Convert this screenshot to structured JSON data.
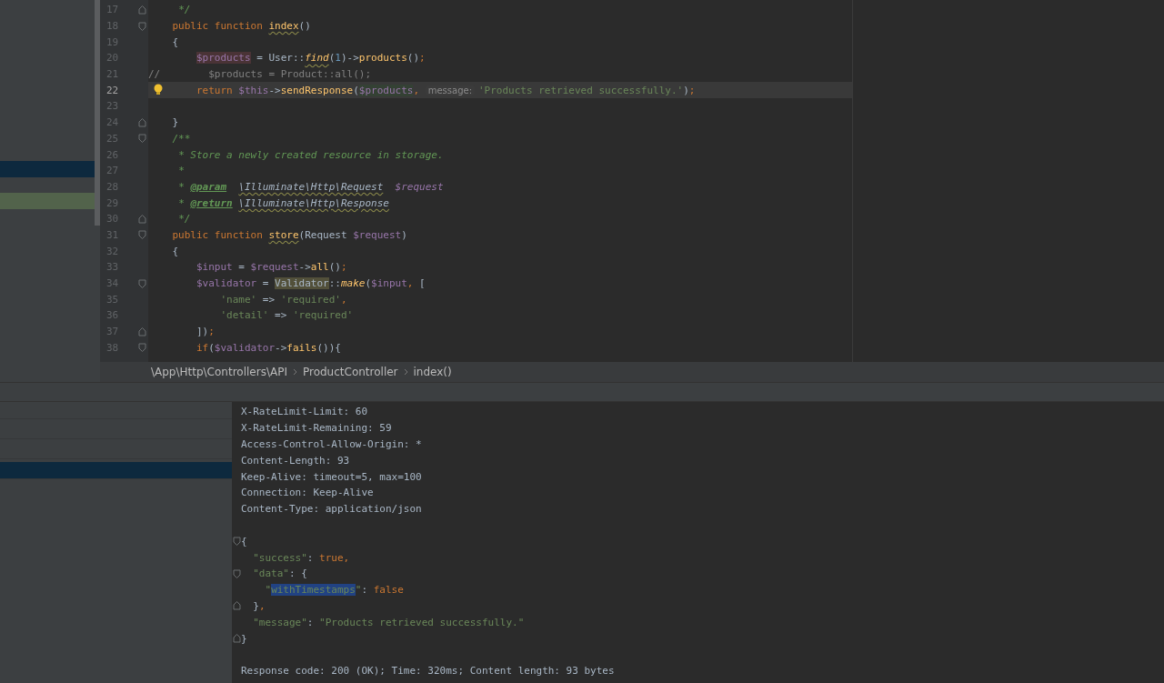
{
  "sidebar": {
    "rows": [
      {
        "selected": false,
        "current": false
      },
      {
        "selected": false,
        "current": false
      },
      {
        "selected": false,
        "current": false
      },
      {
        "selected": false,
        "current": false
      },
      {
        "selected": false,
        "current": false
      },
      {
        "selected": false,
        "current": false
      },
      {
        "selected": false,
        "current": false
      },
      {
        "selected": false,
        "current": false
      },
      {
        "selected": false,
        "current": false
      },
      {
        "selected": false,
        "current": false
      },
      {
        "selected": true,
        "current": false
      },
      {
        "selected": false,
        "current": false
      },
      {
        "selected": false,
        "current": true
      }
    ]
  },
  "editor": {
    "lines": [
      {
        "number": "17",
        "current": false,
        "fold_start": false,
        "fold_end": true,
        "tokens": [
          {
            "kind": "doc",
            "text": "     */"
          }
        ]
      },
      {
        "number": "18",
        "current": false,
        "fold_start": true,
        "fold_end": false,
        "tokens": [
          {
            "kind": "keyword",
            "text": "    public function "
          },
          {
            "kind": "function",
            "text": "index",
            "squiggle": true
          },
          {
            "kind": "plain",
            "text": "()"
          }
        ]
      },
      {
        "number": "19",
        "current": false,
        "fold_start": false,
        "fold_end": false,
        "tokens": [
          {
            "kind": "plain",
            "text": "    {"
          }
        ]
      },
      {
        "number": "20",
        "current": false,
        "fold_start": false,
        "fold_end": false,
        "tokens": [
          {
            "kind": "variable",
            "text": "        $products",
            "highlight": true,
            "color": "#4a3336"
          },
          {
            "kind": "plain",
            "text": " = User::"
          },
          {
            "kind": "static",
            "text": "find",
            "squiggle": true
          },
          {
            "kind": "plain",
            "text": "("
          },
          {
            "kind": "number",
            "text": "1"
          },
          {
            "kind": "plain",
            "text": ")->"
          },
          {
            "kind": "function",
            "text": "products"
          },
          {
            "kind": "plain",
            "text": "()"
          },
          {
            "kind": "keyword",
            "text": ";"
          }
        ]
      },
      {
        "number": "21",
        "current": false,
        "fold_start": false,
        "fold_end": false,
        "tokens": [
          {
            "kind": "dim",
            "text": "//        $products = Product::all();"
          }
        ]
      },
      {
        "number": "22",
        "current": true,
        "bulb": true,
        "fold_start": false,
        "fold_end": false,
        "tokens": [
          {
            "kind": "keyword",
            "text": "        return "
          },
          {
            "kind": "variable",
            "text": "$this"
          },
          {
            "kind": "plain",
            "text": "->"
          },
          {
            "kind": "function",
            "text": "sendResponse"
          },
          {
            "kind": "plain",
            "text": "("
          },
          {
            "kind": "variable",
            "text": "$products",
            "highlight": true,
            "color": "#344134"
          },
          {
            "kind": "keyword",
            "text": ", "
          },
          {
            "kind": "hint",
            "text": "message:"
          },
          {
            "kind": "string",
            "text": "'Products retrieved successfully.'"
          },
          {
            "kind": "plain",
            "text": ")"
          },
          {
            "kind": "keyword",
            "text": ";"
          }
        ]
      },
      {
        "number": "23",
        "current": false,
        "fold_start": false,
        "fold_end": false
      },
      {
        "number": "24",
        "current": false,
        "fold_start": false,
        "fold_end": true,
        "tokens": [
          {
            "kind": "plain",
            "text": "    }"
          }
        ]
      },
      {
        "number": "25",
        "current": false,
        "fold_start": true,
        "fold_end": false,
        "tokens": [
          {
            "kind": "doc",
            "text": "    /**"
          }
        ]
      },
      {
        "number": "26",
        "current": false,
        "fold_start": false,
        "fold_end": false,
        "tokens": [
          {
            "kind": "doc",
            "text": "     * Store a newly created resource in storage."
          }
        ]
      },
      {
        "number": "27",
        "current": false,
        "fold_start": false,
        "fold_end": false,
        "tokens": [
          {
            "kind": "doc",
            "text": "     *"
          }
        ]
      },
      {
        "number": "28",
        "current": false,
        "fold_start": false,
        "fold_end": false,
        "tokens": [
          {
            "kind": "doc",
            "text": "     * "
          },
          {
            "kind": "doctag",
            "text": "@param"
          },
          {
            "kind": "doctype",
            "text": "  \\Illuminate\\Http\\Request",
            "squiggle": true
          },
          {
            "kind": "docvar",
            "text": "  $request"
          }
        ]
      },
      {
        "number": "29",
        "current": false,
        "fold_start": false,
        "fold_end": false,
        "tokens": [
          {
            "kind": "doc",
            "text": "     * "
          },
          {
            "kind": "doctag",
            "text": "@return"
          },
          {
            "kind": "doctype",
            "text": " \\Illuminate\\Http\\Response",
            "squiggle": true
          }
        ]
      },
      {
        "number": "30",
        "current": false,
        "fold_start": false,
        "fold_end": true,
        "tokens": [
          {
            "kind": "doc",
            "text": "     */"
          }
        ]
      },
      {
        "number": "31",
        "current": false,
        "fold_start": true,
        "fold_end": false,
        "tokens": [
          {
            "kind": "keyword",
            "text": "    public function "
          },
          {
            "kind": "function",
            "text": "store",
            "squiggle": true
          },
          {
            "kind": "plain",
            "text": "(Request "
          },
          {
            "kind": "variable",
            "text": "$request"
          },
          {
            "kind": "plain",
            "text": ")"
          }
        ]
      },
      {
        "number": "32",
        "current": false,
        "fold_start": false,
        "fold_end": false,
        "tokens": [
          {
            "kind": "plain",
            "text": "    {"
          }
        ]
      },
      {
        "number": "33",
        "current": false,
        "fold_start": false,
        "fold_end": false,
        "tokens": [
          {
            "kind": "variable",
            "text": "        $input"
          },
          {
            "kind": "plain",
            "text": " = "
          },
          {
            "kind": "variable",
            "text": "$request"
          },
          {
            "kind": "plain",
            "text": "->"
          },
          {
            "kind": "function",
            "text": "all"
          },
          {
            "kind": "plain",
            "text": "()"
          },
          {
            "kind": "keyword",
            "text": ";"
          }
        ]
      },
      {
        "number": "34",
        "current": false,
        "fold_start": true,
        "fold_end": false,
        "tokens": [
          {
            "kind": "variable",
            "text": "        $validator"
          },
          {
            "kind": "plain",
            "text": " = "
          },
          {
            "kind": "plain",
            "text": "Validator",
            "highlight": true,
            "color": "#52503a"
          },
          {
            "kind": "plain",
            "text": "::"
          },
          {
            "kind": "static",
            "text": "make"
          },
          {
            "kind": "plain",
            "text": "("
          },
          {
            "kind": "variable",
            "text": "$input"
          },
          {
            "kind": "keyword",
            "text": ", "
          },
          {
            "kind": "plain",
            "text": "["
          }
        ]
      },
      {
        "number": "35",
        "current": false,
        "fold_start": false,
        "fold_end": false,
        "tokens": [
          {
            "kind": "string",
            "text": "            'name'"
          },
          {
            "kind": "plain",
            "text": " => "
          },
          {
            "kind": "string",
            "text": "'required'"
          },
          {
            "kind": "keyword",
            "text": ","
          }
        ]
      },
      {
        "number": "36",
        "current": false,
        "fold_start": false,
        "fold_end": false,
        "tokens": [
          {
            "kind": "string",
            "text": "            'detail'"
          },
          {
            "kind": "plain",
            "text": " => "
          },
          {
            "kind": "string",
            "text": "'required'"
          }
        ]
      },
      {
        "number": "37",
        "current": false,
        "fold_start": false,
        "fold_end": true,
        "tokens": [
          {
            "kind": "plain",
            "text": "        ])"
          },
          {
            "kind": "keyword",
            "text": ";"
          }
        ]
      },
      {
        "number": "38",
        "current": false,
        "fold_start": true,
        "fold_end": false,
        "tokens": [
          {
            "kind": "keyword",
            "text": "        if"
          },
          {
            "kind": "plain",
            "text": "("
          },
          {
            "kind": "variable",
            "text": "$validator"
          },
          {
            "kind": "plain",
            "text": "->"
          },
          {
            "kind": "function",
            "text": "fails"
          },
          {
            "kind": "plain",
            "text": "()){"
          }
        ]
      }
    ]
  },
  "breadcrumbs": [
    "\\App\\Http\\Controllers\\API",
    "ProductController",
    "index()"
  ],
  "tool_window": {
    "rows": [
      {
        "selected": false
      },
      {
        "selected": false
      },
      {
        "selected": false
      },
      {
        "selected": true
      }
    ]
  },
  "response": {
    "lines": [
      {
        "fold_start": false,
        "fold_end": false,
        "tokens": [
          {
            "kind": "plain",
            "text": "X-RateLimit-Limit: 60"
          }
        ]
      },
      {
        "fold_start": false,
        "fold_end": false,
        "tokens": [
          {
            "kind": "plain",
            "text": "X-RateLimit-Remaining: 59"
          }
        ]
      },
      {
        "fold_start": false,
        "fold_end": false,
        "tokens": [
          {
            "kind": "plain",
            "text": "Access-Control-Allow-Origin: *"
          }
        ]
      },
      {
        "fold_start": false,
        "fold_end": false,
        "tokens": [
          {
            "kind": "plain",
            "text": "Content-Length: 93"
          }
        ]
      },
      {
        "fold_start": false,
        "fold_end": false,
        "tokens": [
          {
            "kind": "plain",
            "text": "Keep-Alive: timeout=5, max=100"
          }
        ]
      },
      {
        "fold_start": false,
        "fold_end": false,
        "tokens": [
          {
            "kind": "plain",
            "text": "Connection: Keep-Alive"
          }
        ]
      },
      {
        "fold_start": false,
        "fold_end": false,
        "tokens": [
          {
            "kind": "plain",
            "text": "Content-Type: application/json"
          }
        ]
      },
      {
        "fold_start": false,
        "fold_end": false
      },
      {
        "fold_start": true,
        "fold_end": false,
        "tokens": [
          {
            "kind": "plain",
            "text": "{"
          }
        ]
      },
      {
        "fold_start": false,
        "fold_end": false,
        "tokens": [
          {
            "kind": "string",
            "text": "  \"success\""
          },
          {
            "kind": "plain",
            "text": ": "
          },
          {
            "kind": "keyword",
            "text": "true,"
          }
        ]
      },
      {
        "fold_start": true,
        "fold_end": false,
        "tokens": [
          {
            "kind": "string",
            "text": "  \"data\""
          },
          {
            "kind": "plain",
            "text": ": {"
          }
        ]
      },
      {
        "fold_start": false,
        "fold_end": false,
        "tokens": [
          {
            "kind": "string",
            "text": "    \""
          },
          {
            "kind": "string",
            "text": "withTimestamps",
            "highlight": true,
            "color": "#214283"
          },
          {
            "kind": "string",
            "text": "\""
          },
          {
            "kind": "plain",
            "text": ": "
          },
          {
            "kind": "keyword",
            "text": "false"
          }
        ]
      },
      {
        "fold_start": false,
        "fold_end": true,
        "tokens": [
          {
            "kind": "plain",
            "text": "  }"
          },
          {
            "kind": "keyword",
            "text": ","
          }
        ]
      },
      {
        "fold_start": false,
        "fold_end": false,
        "tokens": [
          {
            "kind": "string",
            "text": "  \"message\""
          },
          {
            "kind": "plain",
            "text": ": "
          },
          {
            "kind": "string",
            "text": "\"Products retrieved successfully.\""
          }
        ]
      },
      {
        "fold_start": false,
        "fold_end": true,
        "tokens": [
          {
            "kind": "plain",
            "text": "}"
          }
        ]
      },
      {
        "fold_start": false,
        "fold_end": false
      },
      {
        "fold_start": false,
        "fold_end": false,
        "tokens": [
          {
            "kind": "plain",
            "text": "Response code: 200 (OK); Time: 320ms; Content length: 93 bytes"
          }
        ]
      }
    ]
  }
}
